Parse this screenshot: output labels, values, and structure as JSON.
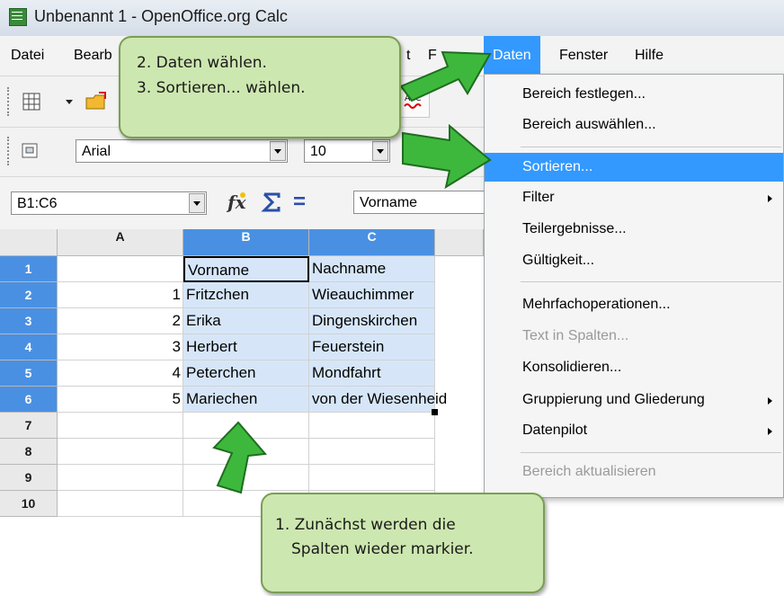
{
  "window": {
    "title": "Unbenannt 1 - OpenOffice.org Calc"
  },
  "menubar": {
    "items": [
      "Datei",
      "Bearb",
      "t",
      "F",
      "Daten",
      "Fenster",
      "Hilfe"
    ]
  },
  "formatbar": {
    "font": "Arial",
    "size": "10"
  },
  "formulabar": {
    "namebox": "B1:C6",
    "content": "Vorname",
    "equals": "="
  },
  "columns": [
    "A",
    "B",
    "C"
  ],
  "rows": [
    "1",
    "2",
    "3",
    "4",
    "5",
    "6",
    "7",
    "8",
    "9",
    "10"
  ],
  "cells": {
    "a": [
      "",
      "1",
      "2",
      "3",
      "4",
      "5"
    ],
    "b": [
      "Vorname",
      "Fritzchen",
      "Erika",
      "Herbert",
      "Peterchen",
      "Mariechen"
    ],
    "c": [
      "Nachname",
      "Wieauchimmer",
      "Dingenskirchen",
      "Feuerstein",
      "Mondfahrt",
      "von der Wiesenheid"
    ]
  },
  "daten_menu": {
    "items": [
      {
        "label": "Bereich festlegen...",
        "state": "normal"
      },
      {
        "label": "Bereich auswählen...",
        "state": "normal"
      },
      {
        "label": "Sortieren...",
        "state": "highlighted"
      },
      {
        "label": "Filter",
        "state": "submenu"
      },
      {
        "label": "Teilergebnisse...",
        "state": "normal"
      },
      {
        "label": "Gültigkeit...",
        "state": "normal"
      },
      {
        "label": "Mehrfachoperationen...",
        "state": "normal"
      },
      {
        "label": "Text in Spalten...",
        "state": "disabled"
      },
      {
        "label": "Konsolidieren...",
        "state": "normal"
      },
      {
        "label": "Gruppierung und Gliederung",
        "state": "submenu"
      },
      {
        "label": "Datenpilot",
        "state": "submenu"
      },
      {
        "label": "Bereich aktualisieren",
        "state": "disabled"
      }
    ]
  },
  "callouts": {
    "top": {
      "line1": "2.  Daten wählen.",
      "line2": "3.  Sortieren... wählen."
    },
    "bottom": {
      "line1": "1. Zunächst werden die",
      "line2": "Spalten wieder markier."
    }
  },
  "colors": {
    "selection": "#d6e6f8",
    "menu_highlight": "#3399ff",
    "callout_fill": "#cde7b0",
    "arrow_green": "#3db83d"
  }
}
